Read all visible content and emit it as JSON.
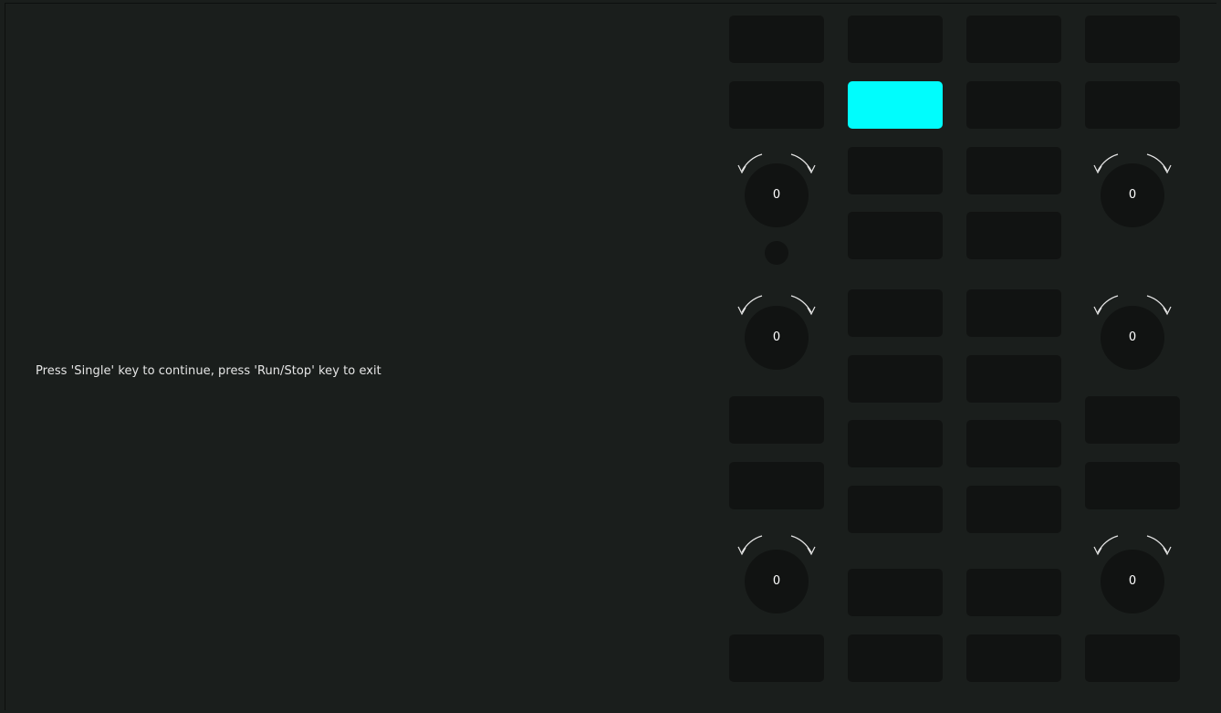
{
  "message": "Press 'Single' key to continue, press 'Run/Stop' key to exit",
  "colors": {
    "background": "#1a1e1c",
    "key": "#111312",
    "active_key": "#00fdfd",
    "text": "#e6e6e6"
  },
  "knobs": {
    "left_1": "0",
    "right_1": "0",
    "left_2": "0",
    "right_2": "0",
    "left_3": "0",
    "right_3": "0"
  },
  "active_key": "row-2-col-2"
}
